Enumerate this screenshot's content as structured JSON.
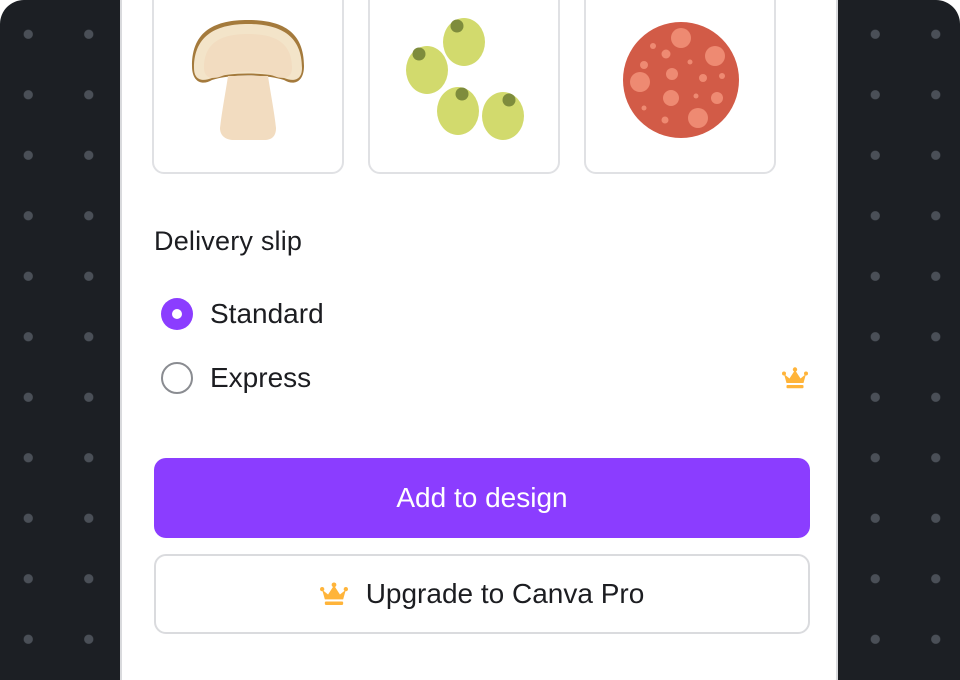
{
  "colors": {
    "accent": "#8b3dff",
    "crown": "#ffb43a",
    "backdrop": "#1c1f24"
  },
  "toppings": [
    {
      "name": "mushroom",
      "icon": "mushroom-icon"
    },
    {
      "name": "olives",
      "icon": "olives-icon"
    },
    {
      "name": "pepperoni",
      "icon": "pepperoni-icon"
    }
  ],
  "delivery": {
    "title": "Delivery slip",
    "options": [
      {
        "label": "Standard",
        "selected": true,
        "pro": false
      },
      {
        "label": "Express",
        "selected": false,
        "pro": true,
        "badge_icon": "crown-icon"
      }
    ]
  },
  "actions": {
    "add_label": "Add to design",
    "upgrade_label": "Upgrade to Canva Pro",
    "upgrade_icon": "crown-icon"
  }
}
